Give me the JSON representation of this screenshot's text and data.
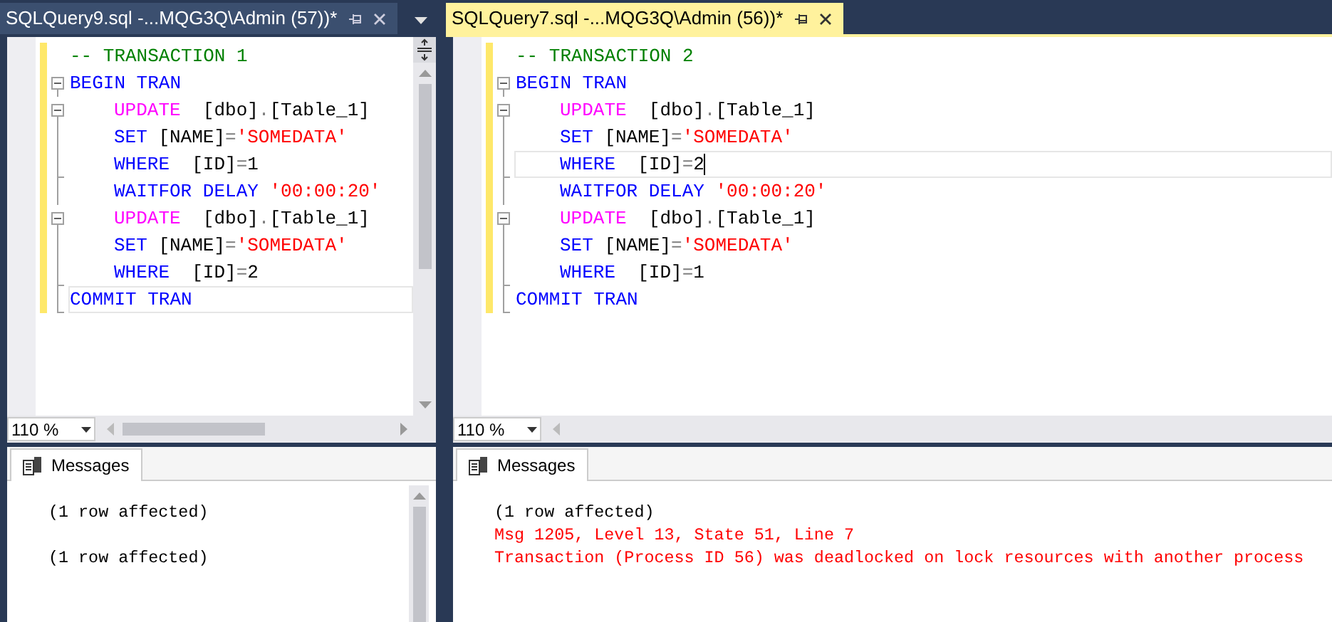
{
  "panes": [
    {
      "tab": {
        "title": "SQLQuery9.sql -...MQG3Q\\Admin (57))*",
        "selected": false
      },
      "tab_list_menu": true,
      "vertical_scrollbar": true,
      "editor": {
        "lines": [
          {
            "kind": "plain",
            "tokens": [
              {
                "kind": "comment",
                "t": "-- TRANSACTION 1"
              }
            ]
          },
          {
            "kind": "fold_start",
            "tokens": [
              {
                "kind": "keyword",
                "t": "BEGIN TRAN"
              }
            ]
          },
          {
            "kind": "fold_start",
            "indent": true,
            "tokens": [
              {
                "kind": "function",
                "t": "UPDATE"
              },
              {
                "kind": "identifier",
                "t": "  [dbo]"
              },
              {
                "kind": "operator",
                "t": "."
              },
              {
                "kind": "identifier",
                "t": "[Table_1]"
              }
            ]
          },
          {
            "kind": "fold_body",
            "indent": true,
            "tokens": [
              {
                "kind": "keyword",
                "t": "SET"
              },
              {
                "kind": "identifier",
                "t": " [NAME]"
              },
              {
                "kind": "operator",
                "t": "="
              },
              {
                "kind": "string",
                "t": "'SOMEDATA'"
              }
            ]
          },
          {
            "kind": "fold_end",
            "indent": true,
            "tokens": [
              {
                "kind": "keyword",
                "t": "WHERE"
              },
              {
                "kind": "identifier",
                "t": "  [ID]"
              },
              {
                "kind": "operator",
                "t": "="
              },
              {
                "kind": "identifier",
                "t": "1"
              }
            ]
          },
          {
            "kind": "fold_body",
            "indent": true,
            "tokens": [
              {
                "kind": "keyword",
                "t": "WAITFOR DELAY "
              },
              {
                "kind": "string",
                "t": "'00:00:20'"
              }
            ]
          },
          {
            "kind": "fold_start",
            "indent": true,
            "tokens": [
              {
                "kind": "function",
                "t": "UPDATE"
              },
              {
                "kind": "identifier",
                "t": "  [dbo]"
              },
              {
                "kind": "operator",
                "t": "."
              },
              {
                "kind": "identifier",
                "t": "[Table_1]"
              }
            ]
          },
          {
            "kind": "fold_body",
            "indent": true,
            "tokens": [
              {
                "kind": "keyword",
                "t": "SET"
              },
              {
                "kind": "identifier",
                "t": " [NAME]"
              },
              {
                "kind": "operator",
                "t": "="
              },
              {
                "kind": "string",
                "t": "'SOMEDATA'"
              }
            ]
          },
          {
            "kind": "fold_end",
            "indent": true,
            "tokens": [
              {
                "kind": "keyword",
                "t": "WHERE"
              },
              {
                "kind": "identifier",
                "t": "  [ID]"
              },
              {
                "kind": "operator",
                "t": "="
              },
              {
                "kind": "identifier",
                "t": "2"
              }
            ]
          },
          {
            "kind": "fold_end",
            "current": true,
            "tokens": [
              {
                "kind": "keyword",
                "t": "COMMIT TRAN"
              }
            ]
          }
        ]
      },
      "zoom": "110 %",
      "messages_tab": "Messages",
      "messages": [
        {
          "kind": "info",
          "text": "(1 row affected)"
        },
        {
          "kind": "blank"
        },
        {
          "kind": "info",
          "text": "(1 row affected)"
        }
      ]
    },
    {
      "tab": {
        "title": "SQLQuery7.sql -...MQG3Q\\Admin (56))*",
        "selected": true
      },
      "editor": {
        "lines": [
          {
            "kind": "plain",
            "tokens": [
              {
                "kind": "comment",
                "t": "-- TRANSACTION 2"
              }
            ]
          },
          {
            "kind": "fold_start",
            "tokens": [
              {
                "kind": "keyword",
                "t": "BEGIN TRAN"
              }
            ]
          },
          {
            "kind": "fold_start",
            "indent": true,
            "tokens": [
              {
                "kind": "function",
                "t": "UPDATE"
              },
              {
                "kind": "identifier",
                "t": "  [dbo]"
              },
              {
                "kind": "operator",
                "t": "."
              },
              {
                "kind": "identifier",
                "t": "[Table_1]"
              }
            ]
          },
          {
            "kind": "fold_body",
            "indent": true,
            "tokens": [
              {
                "kind": "keyword",
                "t": "SET"
              },
              {
                "kind": "identifier",
                "t": " [NAME]"
              },
              {
                "kind": "operator",
                "t": "="
              },
              {
                "kind": "string",
                "t": "'SOMEDATA'"
              }
            ]
          },
          {
            "kind": "fold_end",
            "indent": true,
            "current": true,
            "caret": true,
            "tokens": [
              {
                "kind": "keyword",
                "t": "WHERE"
              },
              {
                "kind": "identifier",
                "t": "  [ID]"
              },
              {
                "kind": "operator",
                "t": "="
              },
              {
                "kind": "identifier",
                "t": "2"
              }
            ]
          },
          {
            "kind": "fold_body",
            "indent": true,
            "tokens": [
              {
                "kind": "keyword",
                "t": "WAITFOR DELAY "
              },
              {
                "kind": "string",
                "t": "'00:00:20'"
              }
            ]
          },
          {
            "kind": "fold_start",
            "indent": true,
            "tokens": [
              {
                "kind": "function",
                "t": "UPDATE"
              },
              {
                "kind": "identifier",
                "t": "  [dbo]"
              },
              {
                "kind": "operator",
                "t": "."
              },
              {
                "kind": "identifier",
                "t": "[Table_1]"
              }
            ]
          },
          {
            "kind": "fold_body",
            "indent": true,
            "tokens": [
              {
                "kind": "keyword",
                "t": "SET"
              },
              {
                "kind": "identifier",
                "t": " [NAME]"
              },
              {
                "kind": "operator",
                "t": "="
              },
              {
                "kind": "string",
                "t": "'SOMEDATA'"
              }
            ]
          },
          {
            "kind": "fold_end",
            "indent": true,
            "tokens": [
              {
                "kind": "keyword",
                "t": "WHERE"
              },
              {
                "kind": "identifier",
                "t": "  [ID]"
              },
              {
                "kind": "operator",
                "t": "="
              },
              {
                "kind": "identifier",
                "t": "1"
              }
            ]
          },
          {
            "kind": "fold_end",
            "tokens": [
              {
                "kind": "keyword",
                "t": "COMMIT TRAN"
              }
            ]
          }
        ]
      },
      "zoom": "110 %",
      "messages_tab": "Messages",
      "messages": [
        {
          "kind": "info",
          "text": "(1 row affected)"
        },
        {
          "kind": "error",
          "text": "Msg 1205, Level 13, State 51, Line 7"
        },
        {
          "kind": "error",
          "text": "Transaction (Process ID 56) was deadlocked on lock resources with another process"
        }
      ]
    }
  ]
}
